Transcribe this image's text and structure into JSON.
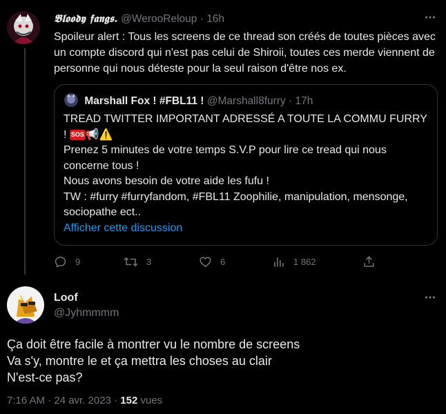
{
  "parent_tweet": {
    "display_name": "𝕭𝖑𝖔𝖔𝖉𝖞 𝖋𝖆𝖓𝖌𝖘.",
    "handle": "@WerooReloup",
    "separator": "·",
    "time": "16h",
    "text": "Spoileur alert : Tous les screens de ce thread son créés de toutes pièces avec un compte discord qui n'est pas celui de Shiroii, toutes ces merde viennent de personne qui nous déteste pour la seul raison d'être nos ex.",
    "quote": {
      "display_name": "Marshall Fox ! #FBL11 !",
      "handle": "@Marshall8furry",
      "separator": "·",
      "time": "17h",
      "line1": "TREAD TWITTER IMPORTANT ADRESSÉ A TOUTE LA COMMU FURRY",
      "line2_prefix": "!",
      "sos_label": "SOS",
      "megaphone": "📢",
      "warning": "⚠️",
      "line3": "Prenez 5 minutes de votre temps S.V.P pour lire ce tread qui nous concerne tous !",
      "line4": "Nous avons besoin de votre aide les fufu !",
      "line5": "TW : #furry #furryfandom, #FBL11 Zoophilie, manipulation, mensonge, sociopathe ect..",
      "show_thread_link": "Afficher cette discussion"
    },
    "actions": {
      "replies": "9",
      "retweets": "3",
      "likes": "6",
      "views": "1 862"
    }
  },
  "reply_tweet": {
    "display_name": "Loof",
    "handle": "@Jyhmmmm",
    "line1": "Ça doit être facile à montrer vu le nombre de screens",
    "line2": "Va s'y, montre le et ça mettra les choses au clair",
    "line3": "N'est-ce pas?",
    "timestamp": "7:16 AM · 24 avr. 2023 ·",
    "views_count": "152",
    "views_label": "vues"
  },
  "colors": {
    "background": "#000000",
    "text": "#e7e9ea",
    "muted": "#71767b",
    "link": "#1d9bf0",
    "border": "#2f3336"
  }
}
